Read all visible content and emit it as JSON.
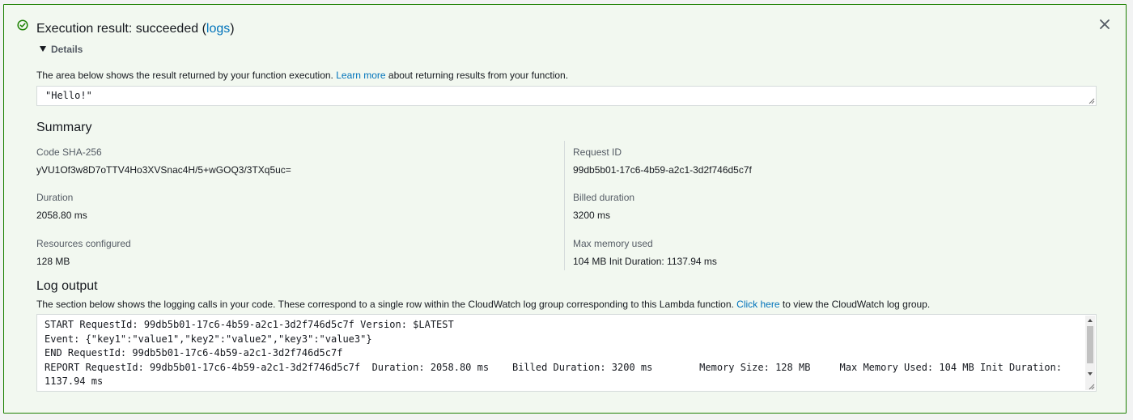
{
  "header": {
    "title_prefix": "Execution result: succeeded (",
    "logs_link": "logs",
    "title_suffix": ")",
    "details_label": "Details",
    "success_color": "#1d8102"
  },
  "result": {
    "desc_prefix": "The area below shows the result returned by your function execution. ",
    "learn_more": "Learn more",
    "desc_suffix": " about returning results from your function.",
    "value": "\"Hello!\""
  },
  "summary": {
    "title": "Summary",
    "code_sha_label": "Code SHA-256",
    "code_sha_value": "yVU1Of3w8D7oTTV4Ho3XVSnac4H/5+wGOQ3/3TXq5uc=",
    "request_id_label": "Request ID",
    "request_id_value": "99db5b01-17c6-4b59-a2c1-3d2f746d5c7f",
    "duration_label": "Duration",
    "duration_value": "2058.80 ms",
    "billed_label": "Billed duration",
    "billed_value": "3200 ms",
    "resources_label": "Resources configured",
    "resources_value": "128 MB",
    "max_memory_label": "Max memory used",
    "max_memory_value": "104 MB Init Duration: 1137.94 ms"
  },
  "log": {
    "title": "Log output",
    "desc_prefix": "The section below shows the logging calls in your code. These correspond to a single row within the CloudWatch log group corresponding to this Lambda function. ",
    "click_here": "Click here",
    "desc_suffix": " to view the CloudWatch log group.",
    "lines": [
      "START RequestId: 99db5b01-17c6-4b59-a2c1-3d2f746d5c7f Version: $LATEST",
      "Event: {\"key1\":\"value1\",\"key2\":\"value2\",\"key3\":\"value3\"}",
      "END RequestId: 99db5b01-17c6-4b59-a2c1-3d2f746d5c7f",
      "REPORT RequestId: 99db5b01-17c6-4b59-a2c1-3d2f746d5c7f  Duration: 2058.80 ms    Billed Duration: 3200 ms        Memory Size: 128 MB     Max Memory Used: 104 MB Init Duration:",
      "1137.94 ms"
    ]
  }
}
